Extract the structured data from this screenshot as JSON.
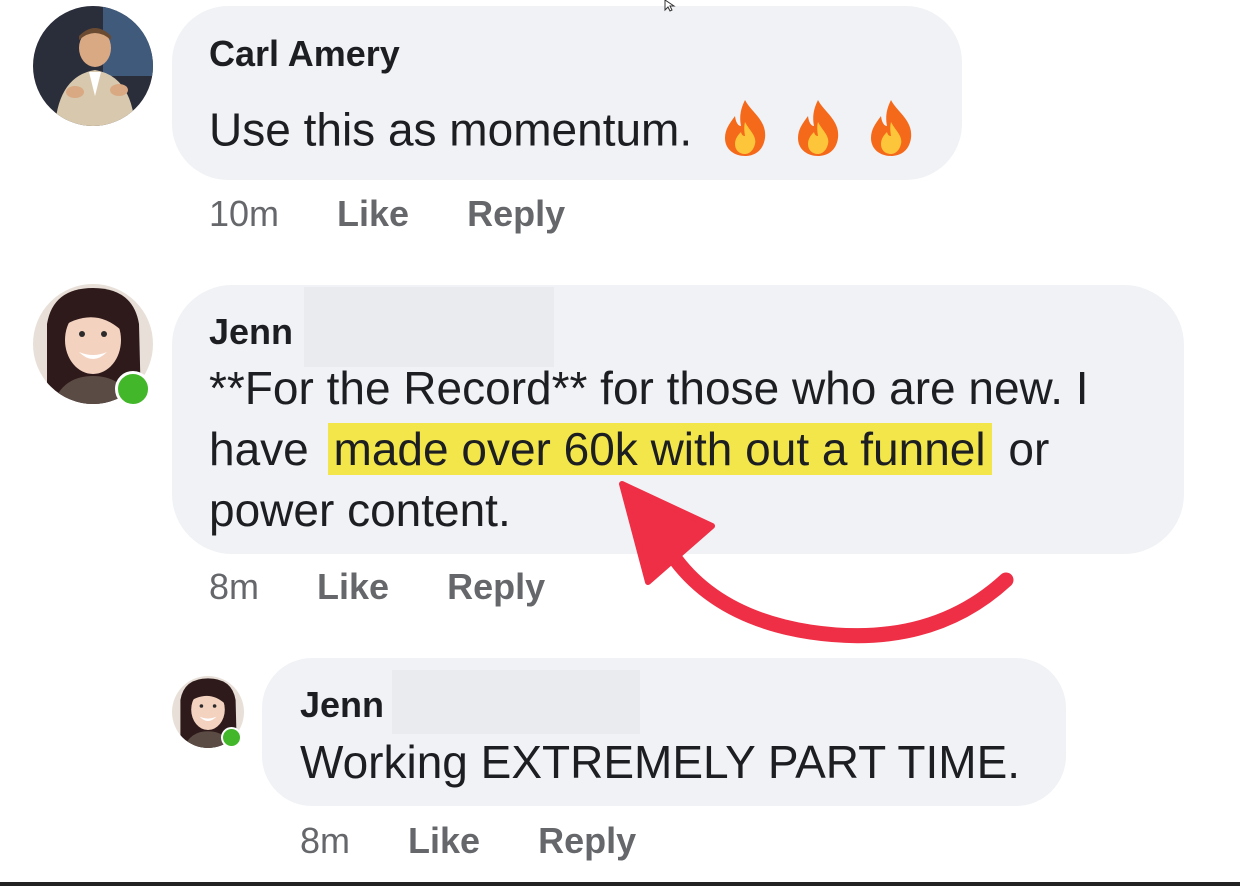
{
  "comments": [
    {
      "author": "Carl Amery",
      "text": "Use this as momentum.",
      "emoji": "fire-icon",
      "time": "10m",
      "like_label": "Like",
      "reply_label": "Reply"
    },
    {
      "author": "Jenn",
      "line1": "**For the Record** for those who are new. I",
      "line2_pre": "have",
      "line2_highlight": "made over 60k with out a funnel",
      "line2_post": "or",
      "line3": "power content.",
      "time": "8m",
      "like_label": "Like",
      "reply_label": "Reply",
      "online": true
    }
  ],
  "reply": {
    "author": "Jenn",
    "text": "Working EXTREMELY PART TIME.",
    "time": "8m",
    "like_label": "Like",
    "reply_label": "Reply",
    "online": true
  },
  "colors": {
    "bubble": "#f0f2f5",
    "highlight": "#f2e64a",
    "arrow": "#ee2f45",
    "online": "#42b72a",
    "meta_text": "#65676b"
  }
}
